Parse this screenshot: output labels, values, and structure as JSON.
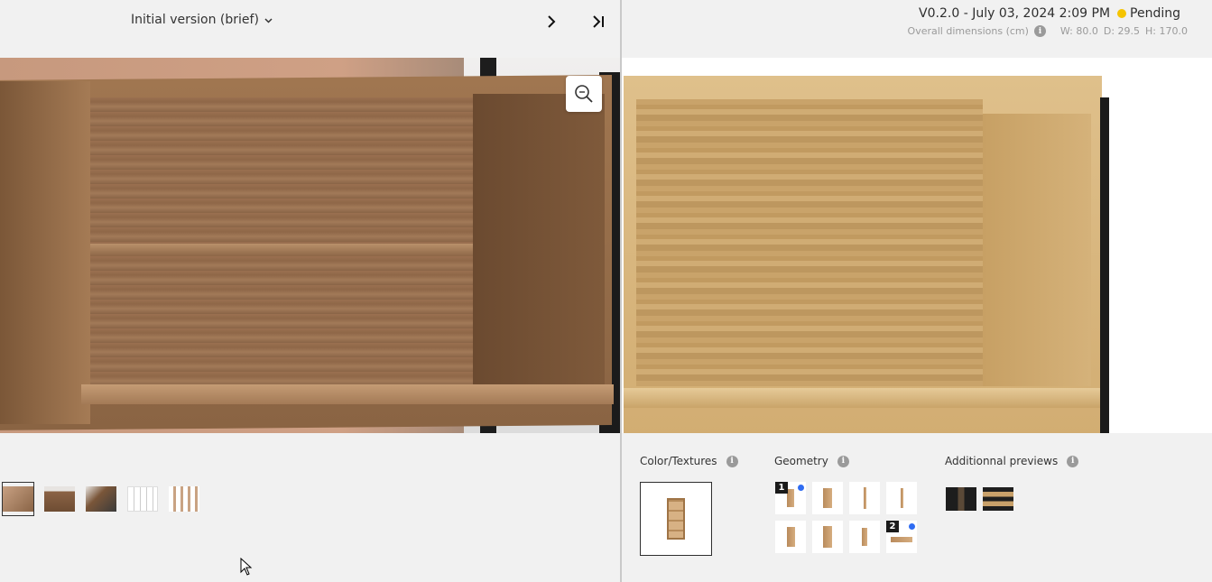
{
  "left": {
    "version_selector": "Initial version (brief)",
    "thumbnails": [
      {
        "name": "thumbnail-1",
        "active": true
      },
      {
        "name": "thumbnail-2",
        "active": false
      },
      {
        "name": "thumbnail-3",
        "active": false
      },
      {
        "name": "thumbnail-4",
        "active": false
      },
      {
        "name": "thumbnail-5",
        "active": false
      }
    ],
    "icons": {
      "next": "chevron-right-icon",
      "last": "skip-to-end-icon",
      "zoom": "zoom-in-icon"
    }
  },
  "right": {
    "version": "V0.2.0 - July 03, 2024 2:09 PM",
    "status": "Pending",
    "status_color": "#f5c400",
    "dimensions_label": "Overall dimensions (cm)",
    "dim_w": "W: 80.0",
    "dim_d": "D: 29.5",
    "dim_h": "H: 170.0",
    "panels": {
      "color_textures": "Color/Textures",
      "geometry": "Geometry",
      "additional_previews": "Additionnal previews"
    },
    "geometry_badges": {
      "first": "1",
      "second": "2"
    },
    "accent_blue": "#2f6cf2"
  }
}
